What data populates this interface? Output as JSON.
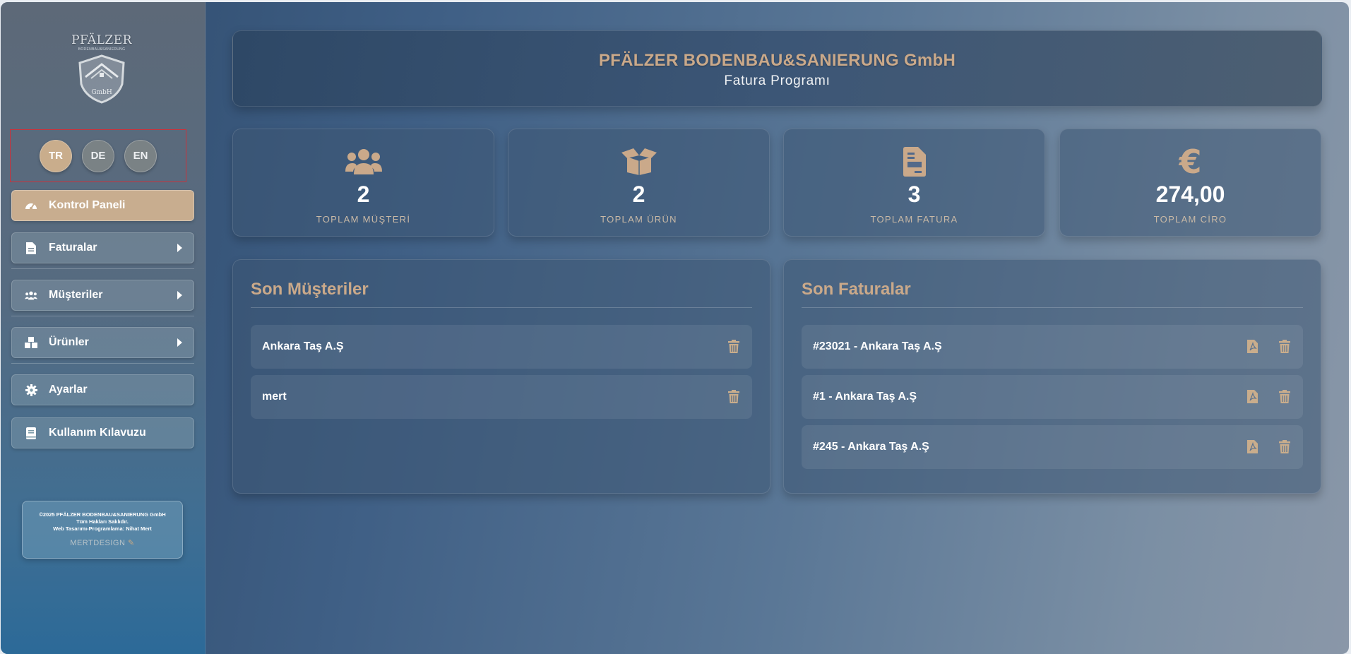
{
  "app": {
    "company_name": "PFÄLZER BODENBAU&SANIERUNG GmbH",
    "subtitle": "Fatura Programı"
  },
  "logo": {
    "text": "PFÄLZER",
    "subtext": "BODENBAU&SANIERUNG",
    "badge_text": "GmbH"
  },
  "languages": [
    {
      "code": "TR",
      "active": true
    },
    {
      "code": "DE",
      "active": false
    },
    {
      "code": "EN",
      "active": false
    }
  ],
  "sidebar": {
    "items": [
      {
        "label": "Kontrol Paneli",
        "icon": "dashboard-icon",
        "active": true,
        "expandable": false
      },
      {
        "label": "Faturalar",
        "icon": "invoice-icon",
        "active": false,
        "expandable": true
      },
      {
        "label": "Müşteriler",
        "icon": "users-icon",
        "active": false,
        "expandable": true
      },
      {
        "label": "Ürünler",
        "icon": "boxes-icon",
        "active": false,
        "expandable": true
      },
      {
        "label": "Ayarlar",
        "icon": "gear-icon",
        "active": false,
        "expandable": false
      },
      {
        "label": "Kullanım Kılavuzu",
        "icon": "book-icon",
        "active": false,
        "expandable": false
      }
    ]
  },
  "footer": {
    "line1": "©2025 PFÄLZER BODENBAU&SANIERUNG GmbH",
    "line2": "Tüm Hakları Saklıdır.",
    "line3": "Web Tasarımı-Programlama: Nihat Mert",
    "brand": "MERTDESIGN"
  },
  "stats": [
    {
      "value": "2",
      "label": "TOPLAM MÜŞTERİ",
      "icon": "users-icon"
    },
    {
      "value": "2",
      "label": "TOPLAM ÜRÜN",
      "icon": "box-open-icon"
    },
    {
      "value": "3",
      "label": "TOPLAM FATURA",
      "icon": "invoice-icon"
    },
    {
      "value": "274,00",
      "label": "TOPLAM CİRO",
      "icon": "euro-icon"
    }
  ],
  "recent_customers": {
    "title": "Son Müşteriler",
    "rows": [
      "Ankara Taş A.Ş",
      "mert"
    ]
  },
  "recent_invoices": {
    "title": "Son Faturalar",
    "rows": [
      "#23021 - Ankara Taş A.Ş",
      "#1 - Ankara Taş A.Ş",
      "#245 - Ankara Taş A.Ş"
    ]
  },
  "colors": {
    "accent": "#c9ad8c",
    "highlight_border": "#c9323c"
  }
}
